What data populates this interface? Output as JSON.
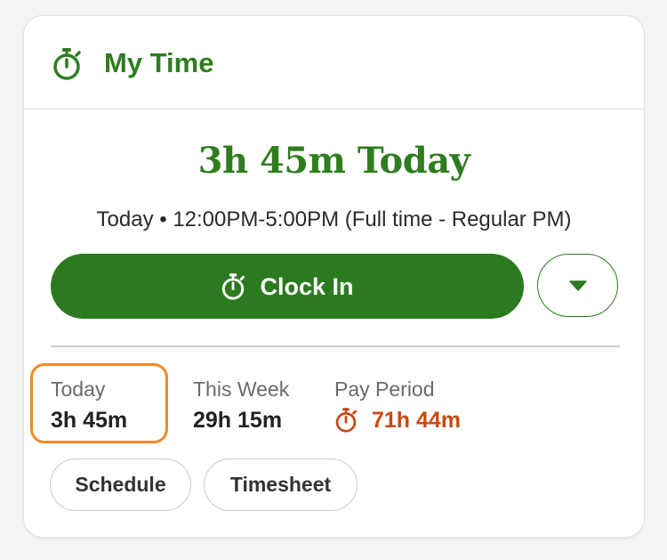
{
  "header": {
    "title": "My Time",
    "icon": "stopwatch-icon",
    "accent_color": "#2e7d1f"
  },
  "summary": {
    "total_today": "3h 45m Today",
    "shift": "Today • 12:00PM-5:00PM (Full time - Regular PM)"
  },
  "actions": {
    "clock_in_label": "Clock In",
    "clock_in_icon": "stopwatch-icon",
    "dropdown_icon": "caret-down-icon",
    "button_color": "#2b7a1f"
  },
  "stats": {
    "today": {
      "label": "Today",
      "value": "3h 45m",
      "highlighted": true,
      "highlight_color": "#f08a24"
    },
    "this_week": {
      "label": "This Week",
      "value": "29h 15m"
    },
    "pay_period": {
      "label": "Pay Period",
      "value": "71h 44m",
      "icon": "stopwatch-icon",
      "color": "#c64a12"
    }
  },
  "links": {
    "schedule_label": "Schedule",
    "timesheet_label": "Timesheet"
  }
}
